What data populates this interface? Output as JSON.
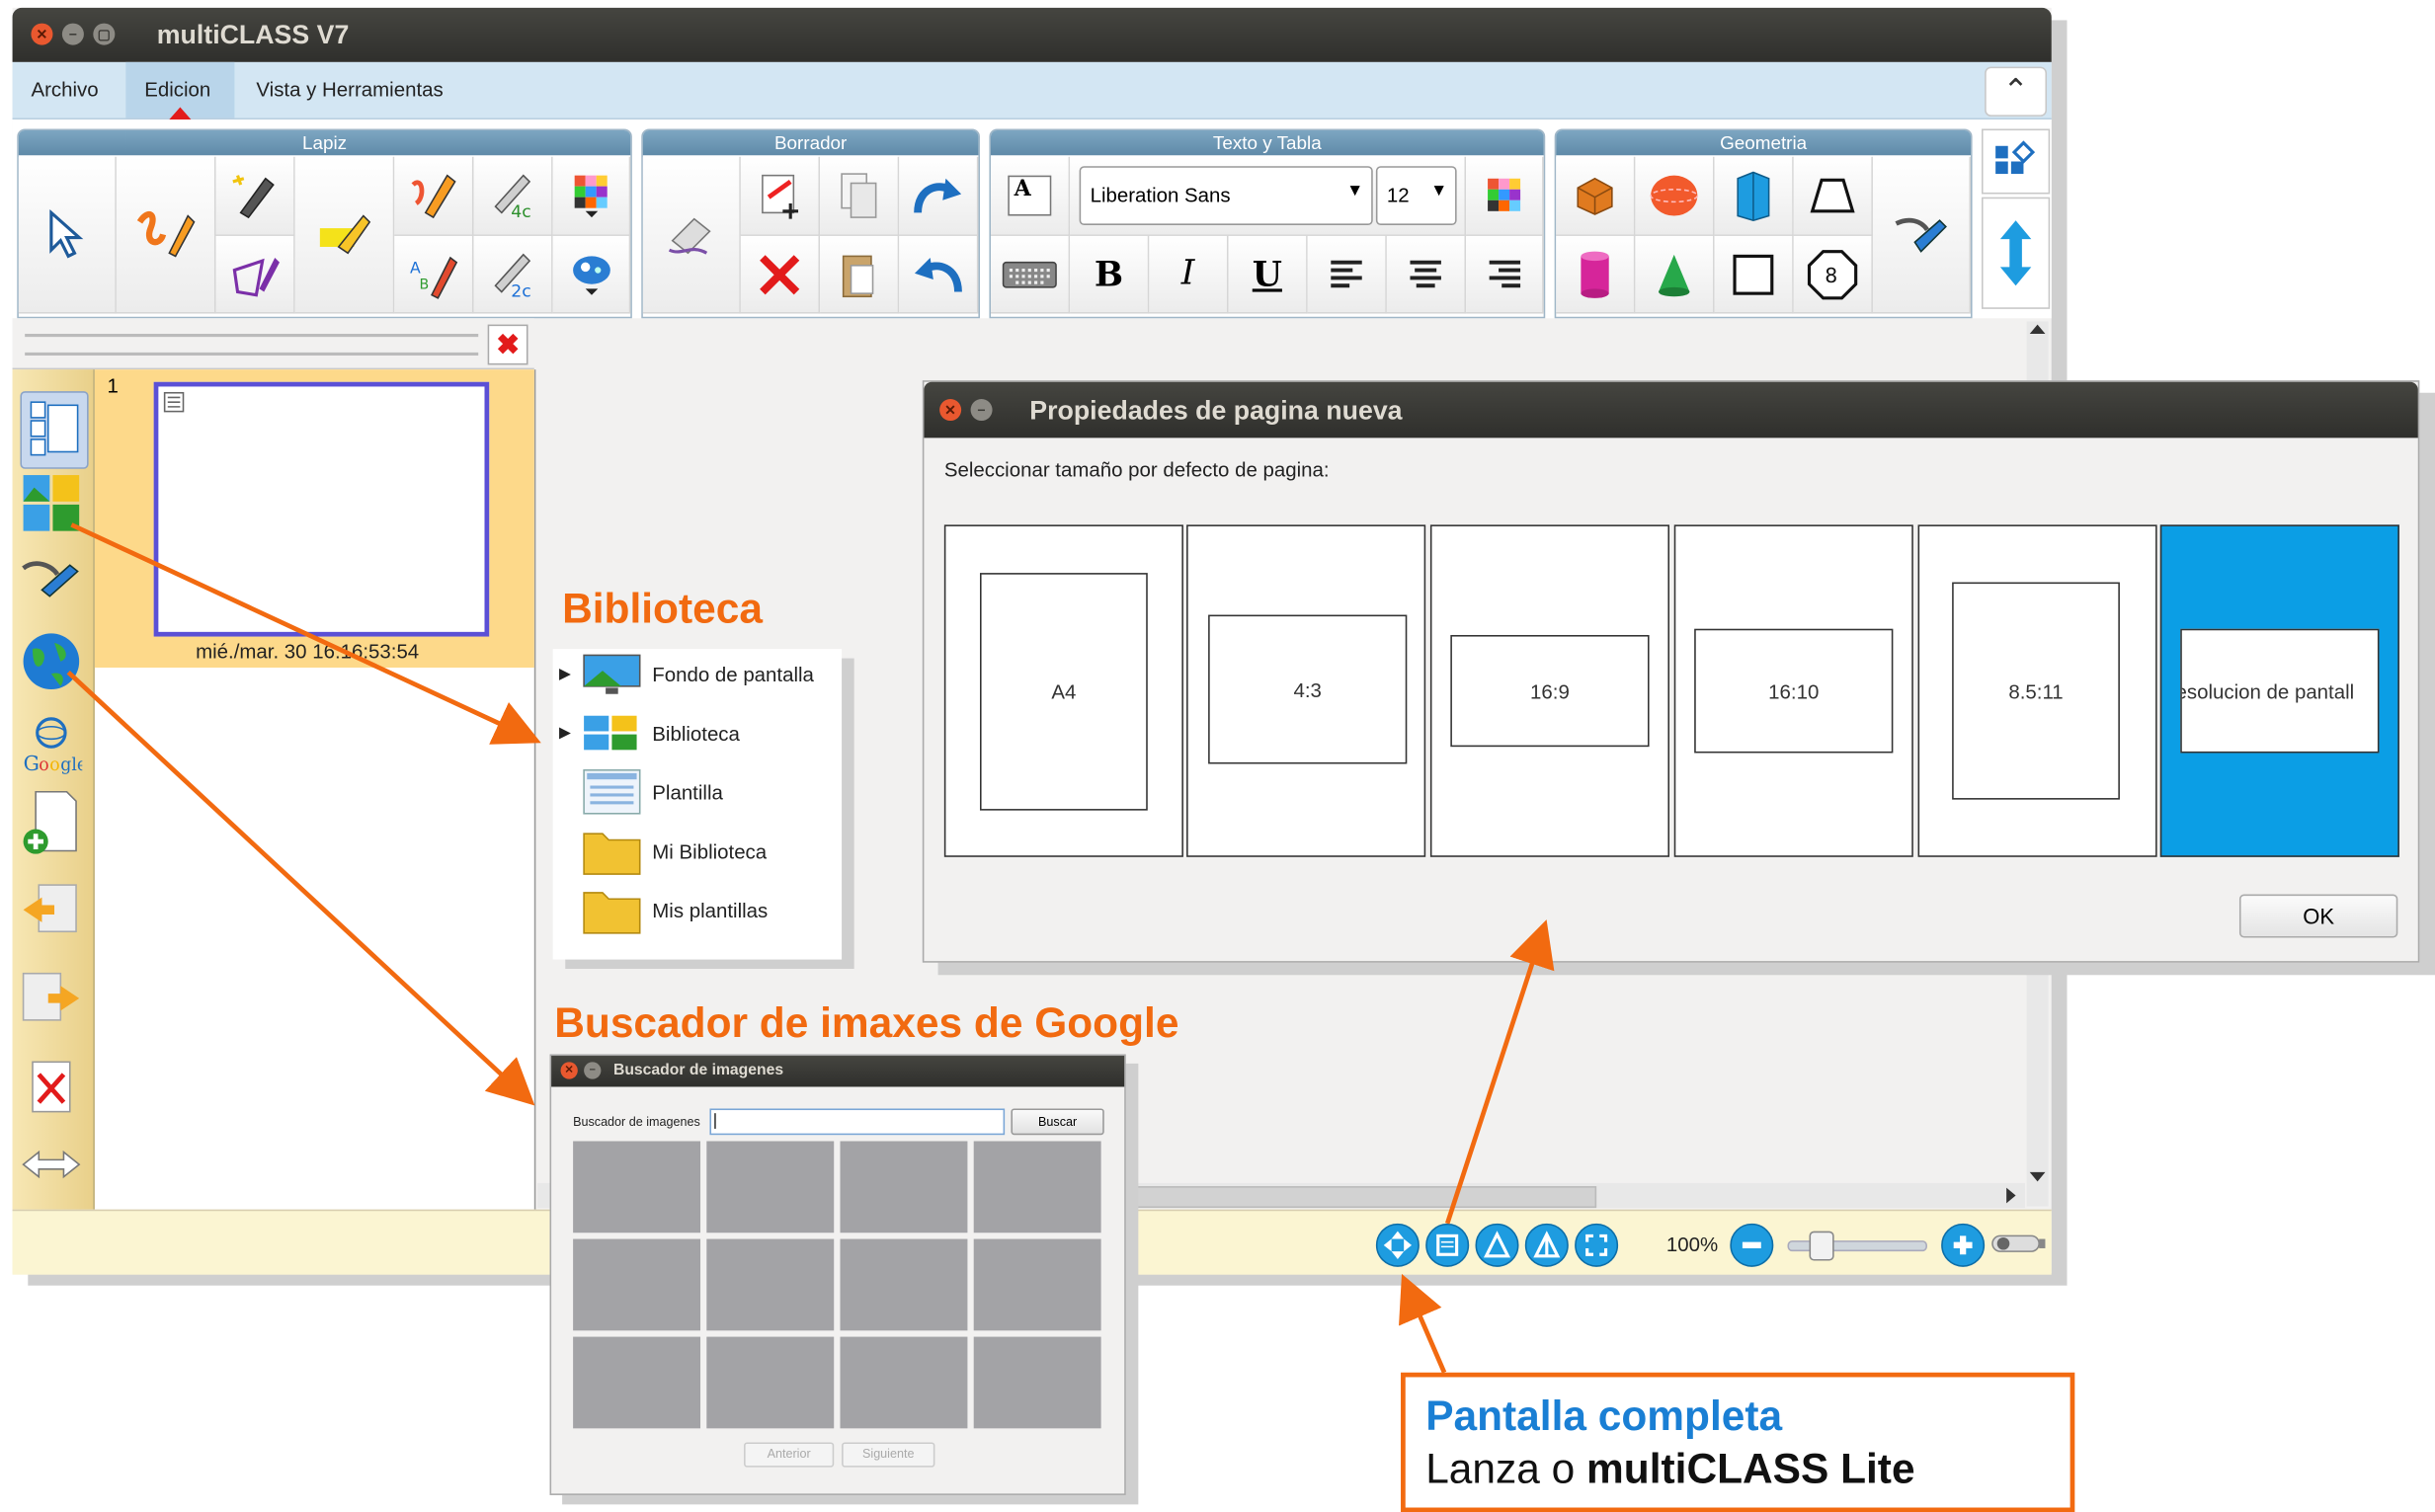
{
  "app_title": "multiCLASS V7",
  "menu": [
    "Archivo",
    "Edicion",
    "Vista y Herramientas"
  ],
  "ribbon": {
    "lapiz": "Lapiz",
    "borrador": "Borrador",
    "texto_tabla": "Texto y Tabla",
    "geometria": "Geometria",
    "font_name": "Liberation Sans",
    "font_size": "12",
    "bold": "B",
    "italic": "I",
    "underline": "U",
    "text_icon": "A",
    "octagon_label": "8",
    "pen_label_4c": "4c",
    "pen_label_2c": "2c"
  },
  "sidebar": {
    "page_number": "1",
    "page_timestamp": "mié./mar. 30 16:16:53:54"
  },
  "library": {
    "title": "Biblioteca",
    "items": [
      "Fondo de pantalla",
      "Biblioteca",
      "Plantilla",
      "Mi Biblioteca",
      "Mis plantillas"
    ]
  },
  "google": {
    "annotation": "Buscador de imaxes de Google",
    "window_title": "Buscador de imagenes",
    "search_label": "Buscador de imagenes",
    "search_value": "",
    "search_button": "Buscar",
    "prev_button": "Anterior",
    "next_button": "Siguiente"
  },
  "dialog": {
    "title": "Propiedades de pagina nueva",
    "prompt": "Seleccionar tamaño por defecto de pagina:",
    "sizes": [
      "A4",
      "4:3",
      "16:9",
      "16:10",
      "8.5:11",
      "esolucion de pantall"
    ],
    "selected_index": 5,
    "ok": "OK"
  },
  "statusbar": {
    "zoom": "100%",
    "zoom_level": 0.17
  },
  "fullscreen_note": {
    "title": "Pantalla completa",
    "text_prefix": "Lanza o ",
    "text_bold": "multiCLASS Lite"
  },
  "colors": {
    "accent_orange": "#f26a10",
    "selected_blue": "#0b9ee5",
    "title_blue": "#1a7fd4",
    "ribbon_header": "#6f98b6"
  }
}
